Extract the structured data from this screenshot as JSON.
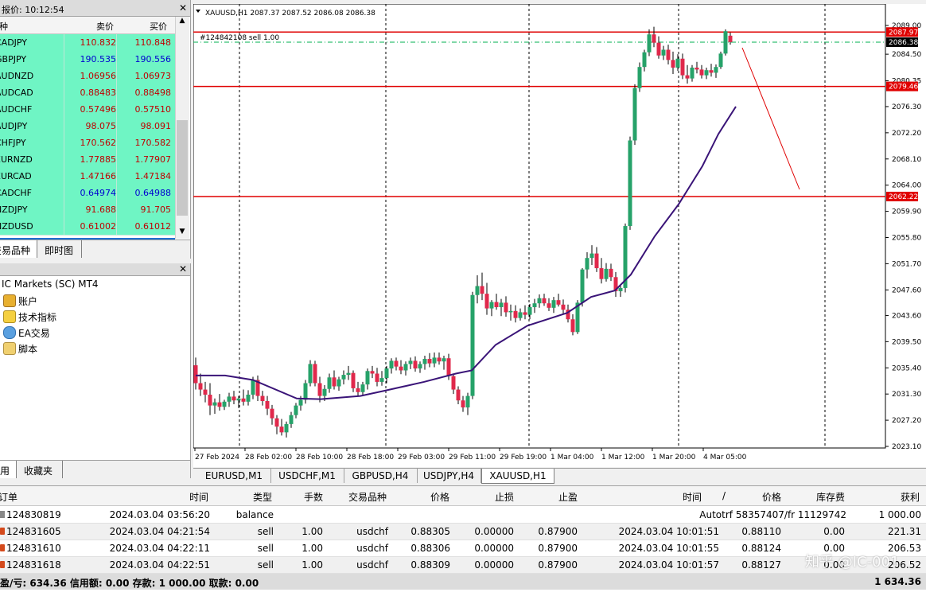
{
  "market_watch": {
    "title": "报价: 10:12:54",
    "close": "✕",
    "col_symbol": "品种",
    "col_bid": "卖价",
    "col_ask": "买价",
    "rows": [
      {
        "symbol": "CADJPY",
        "bid": "110.832",
        "ask": "110.848",
        "color": "#c00000"
      },
      {
        "symbol": "GBPJPY",
        "bid": "190.535",
        "ask": "190.556",
        "color": "#0000d0"
      },
      {
        "symbol": "AUDNZD",
        "bid": "1.06956",
        "ask": "1.06973",
        "color": "#c00000"
      },
      {
        "symbol": "AUDCAD",
        "bid": "0.88483",
        "ask": "0.88498",
        "color": "#c00000"
      },
      {
        "symbol": "AUDCHF",
        "bid": "0.57496",
        "ask": "0.57510",
        "color": "#c00000"
      },
      {
        "symbol": "AUDJPY",
        "bid": "98.075",
        "ask": "98.091",
        "color": "#c00000"
      },
      {
        "symbol": "CHFJPY",
        "bid": "170.562",
        "ask": "170.582",
        "color": "#c00000"
      },
      {
        "symbol": "EURNZD",
        "bid": "1.77885",
        "ask": "1.77907",
        "color": "#c00000"
      },
      {
        "symbol": "EURCAD",
        "bid": "1.47166",
        "ask": "1.47184",
        "color": "#c00000"
      },
      {
        "symbol": "CADCHF",
        "bid": "0.64974",
        "ask": "0.64988",
        "color": "#0000d0"
      },
      {
        "symbol": "NZDJPY",
        "bid": "91.688",
        "ask": "91.705",
        "color": "#c00000"
      },
      {
        "symbol": "NZDUSD",
        "bid": "0.61002",
        "ask": "0.61012",
        "color": "#c00000"
      }
    ],
    "tabs": [
      "交易品种",
      "即时图"
    ]
  },
  "navigator": {
    "close": "✕",
    "root": "IC Markets (SC) MT4",
    "items": [
      {
        "label": "账户",
        "icon": "accounts-icon"
      },
      {
        "label": "技术指标",
        "icon": "indicators-icon"
      },
      {
        "label": "EA交易",
        "icon": "expert-advisors-icon"
      },
      {
        "label": "脚本",
        "icon": "scripts-icon"
      }
    ],
    "tabs": [
      "常用",
      "收藏夹"
    ]
  },
  "chart": {
    "header": "XAUUSD,H1  2087.37 2087.52 2086.08 2086.38",
    "order_label": "#124842108 sell 1.00",
    "line_labels": [
      "2087.97",
      "2086.38",
      "2079.46",
      "2062.22"
    ],
    "price_axis": [
      "2089.00",
      "2084.50",
      "2080.35",
      "2076.30",
      "2072.20",
      "2068.10",
      "2064.00",
      "2059.90",
      "2055.80",
      "2051.70",
      "2047.60",
      "2043.60",
      "2039.50",
      "2035.40",
      "2031.30",
      "2027.20",
      "2023.10"
    ],
    "time_axis": [
      "27 Feb 2024",
      "28 Feb 02:00",
      "28 Feb 10:00",
      "28 Feb 18:00",
      "29 Feb 03:00",
      "29 Feb 11:00",
      "29 Feb 19:00",
      "1 Mar 04:00",
      "1 Mar 12:00",
      "1 Mar 20:00",
      "4 Mar 05:00"
    ],
    "colors": {
      "bull": "#26a269",
      "bear": "#e0284b",
      "ma": "#3a1478",
      "level": "#e00000",
      "bid": "#00b050"
    }
  },
  "chart_tabs": [
    "EURUSD,M1",
    "USDCHF,M1",
    "GBPUSD,H4",
    "USDJPY,H4",
    "XAUUSD,H1"
  ],
  "terminal": {
    "headers": {
      "order": "订单",
      "time": "时间",
      "type": "类型",
      "lots": "手数",
      "symbol": "交易品种",
      "price": "价格",
      "sl": "止损",
      "tp": "止盈",
      "close_time": "时间",
      "close_price": "价格",
      "swap": "库存费",
      "profit": "获利"
    },
    "sort_marker": "/",
    "balance_row": {
      "order": "124830819",
      "time": "2024.03.04 03:56:20",
      "type": "balance",
      "comment": "Autotrf 58357407/fr 11129742",
      "profit": "1 000.00"
    },
    "trades": [
      {
        "order": "124831605",
        "time": "2024.03.04 04:21:54",
        "type": "sell",
        "lots": "1.00",
        "symbol": "usdchf",
        "price": "0.88305",
        "sl": "0.00000",
        "tp": "0.87900",
        "close_time": "2024.03.04 10:01:51",
        "close_price": "0.88110",
        "swap": "0.00",
        "profit": "221.31"
      },
      {
        "order": "124831610",
        "time": "2024.03.04 04:22:11",
        "type": "sell",
        "lots": "1.00",
        "symbol": "usdchf",
        "price": "0.88306",
        "sl": "0.00000",
        "tp": "0.87900",
        "close_time": "2024.03.04 10:01:55",
        "close_price": "0.88124",
        "swap": "0.00",
        "profit": "206.53"
      },
      {
        "order": "124831618",
        "time": "2024.03.04 04:22:51",
        "type": "sell",
        "lots": "1.00",
        "symbol": "usdchf",
        "price": "0.88309",
        "sl": "0.00000",
        "tp": "0.87900",
        "close_time": "2024.03.04 10:01:57",
        "close_price": "0.88127",
        "swap": "0.00",
        "profit": "206.52"
      }
    ],
    "summary": "盈/亏: 634.36  信用额: 0.00  存款: 1 000.00  取款: 0.00",
    "summary_total": "1 634.36",
    "watermark": "知乎 @IC-001"
  }
}
